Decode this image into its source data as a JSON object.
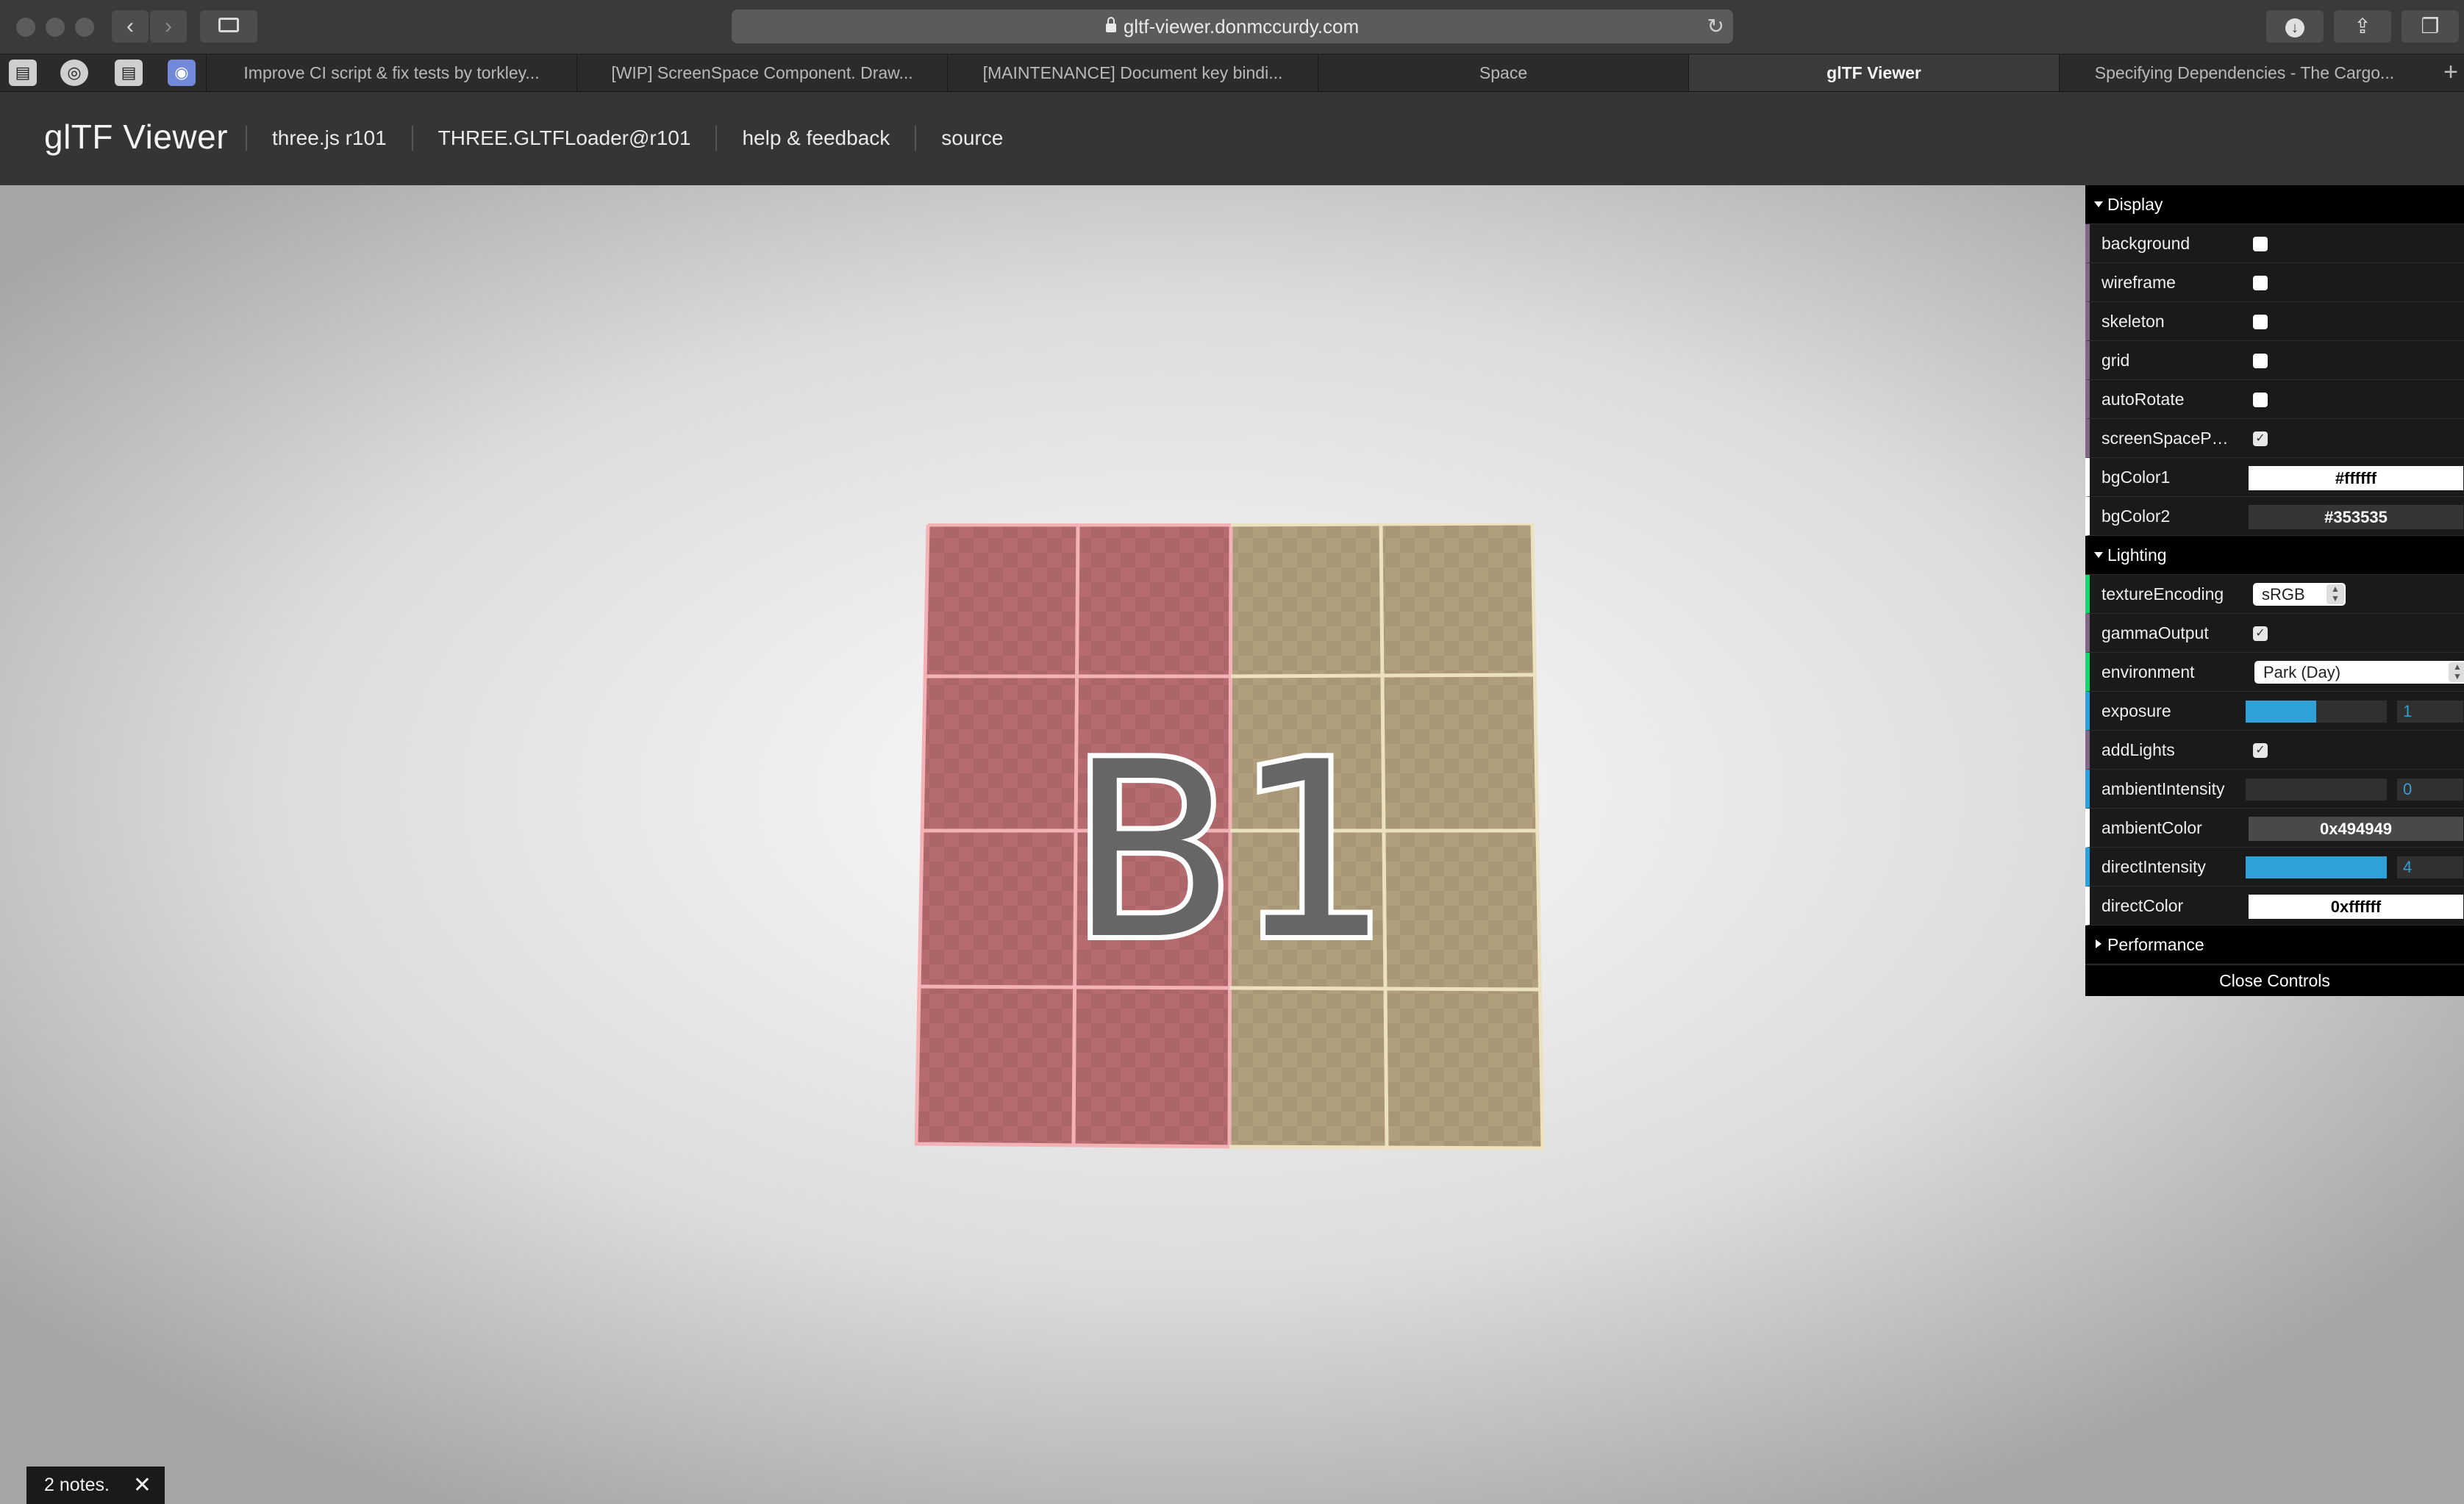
{
  "browser": {
    "url": "gltf-viewer.donmccurdy.com",
    "pinned_tabs": [
      "page-icon",
      "github-icon",
      "page-icon",
      "discord-icon"
    ],
    "tabs": [
      {
        "label": "Improve CI script & fix tests by torkley..."
      },
      {
        "label": "[WIP] ScreenSpace Component. Draw..."
      },
      {
        "label": "[MAINTENANCE] Document key bindi..."
      },
      {
        "label": "Space"
      },
      {
        "label": "glTF Viewer",
        "active": true
      },
      {
        "label": "Specifying Dependencies - The Cargo..."
      }
    ]
  },
  "header": {
    "title": "glTF Viewer",
    "links": [
      "three.js r101",
      "THREE.GLTFLoader@r101",
      "help & feedback",
      "source"
    ]
  },
  "model": {
    "label": "B1",
    "colors": {
      "left": "#b86a6e",
      "right": "#b3a27c",
      "grid_left": "#f1a8ad",
      "grid_right": "#efe4bf"
    }
  },
  "controls": {
    "display": {
      "title": "Display",
      "background": {
        "label": "background",
        "checked": false
      },
      "wireframe": {
        "label": "wireframe",
        "checked": false
      },
      "skeleton": {
        "label": "skeleton",
        "checked": false
      },
      "grid": {
        "label": "grid",
        "checked": false
      },
      "autoRotate": {
        "label": "autoRotate",
        "checked": false
      },
      "screenSpacePanning": {
        "label": "screenSpacePan...",
        "checked": true
      },
      "bgColor1": {
        "label": "bgColor1",
        "value": "#ffffff",
        "bg": "#ffffff",
        "fg": "#000000"
      },
      "bgColor2": {
        "label": "bgColor2",
        "value": "#353535",
        "bg": "#353535",
        "fg": "#ffffff"
      }
    },
    "lighting": {
      "title": "Lighting",
      "textureEncoding": {
        "label": "textureEncoding",
        "value": "sRGB"
      },
      "gammaOutput": {
        "label": "gammaOutput",
        "checked": true
      },
      "environment": {
        "label": "environment",
        "value": "Park (Day)"
      },
      "exposure": {
        "label": "exposure",
        "value": "1",
        "fraction": 0.5
      },
      "addLights": {
        "label": "addLights",
        "checked": true
      },
      "ambientIntensity": {
        "label": "ambientIntensity",
        "value": "0",
        "fraction": 0
      },
      "ambientColor": {
        "label": "ambientColor",
        "value": "0x494949",
        "bg": "#494949",
        "fg": "#ffffff"
      },
      "directIntensity": {
        "label": "directIntensity",
        "value": "4",
        "fraction": 1
      },
      "directColor": {
        "label": "directColor",
        "value": "0xffffff",
        "bg": "#ffffff",
        "fg": "#000000"
      }
    },
    "performance": {
      "title": "Performance"
    },
    "close_label": "Close Controls"
  },
  "notes": {
    "label": "2 notes.",
    "close": "✕"
  }
}
